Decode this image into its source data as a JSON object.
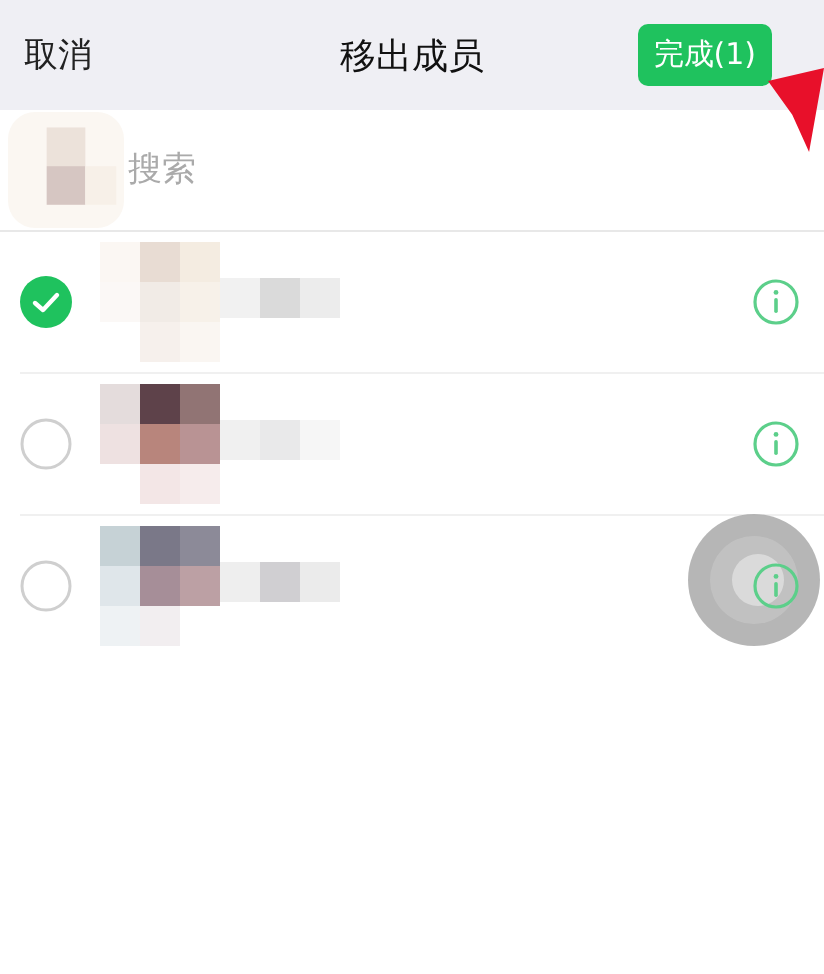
{
  "nav_bar": {
    "cancel": "取消",
    "title": "移出成员",
    "done_button": "完成(1)"
  },
  "search": {
    "placeholder": "搜索"
  },
  "members": [
    {
      "checked": true
    },
    {
      "checked": false
    },
    {
      "checked": false
    }
  ]
}
